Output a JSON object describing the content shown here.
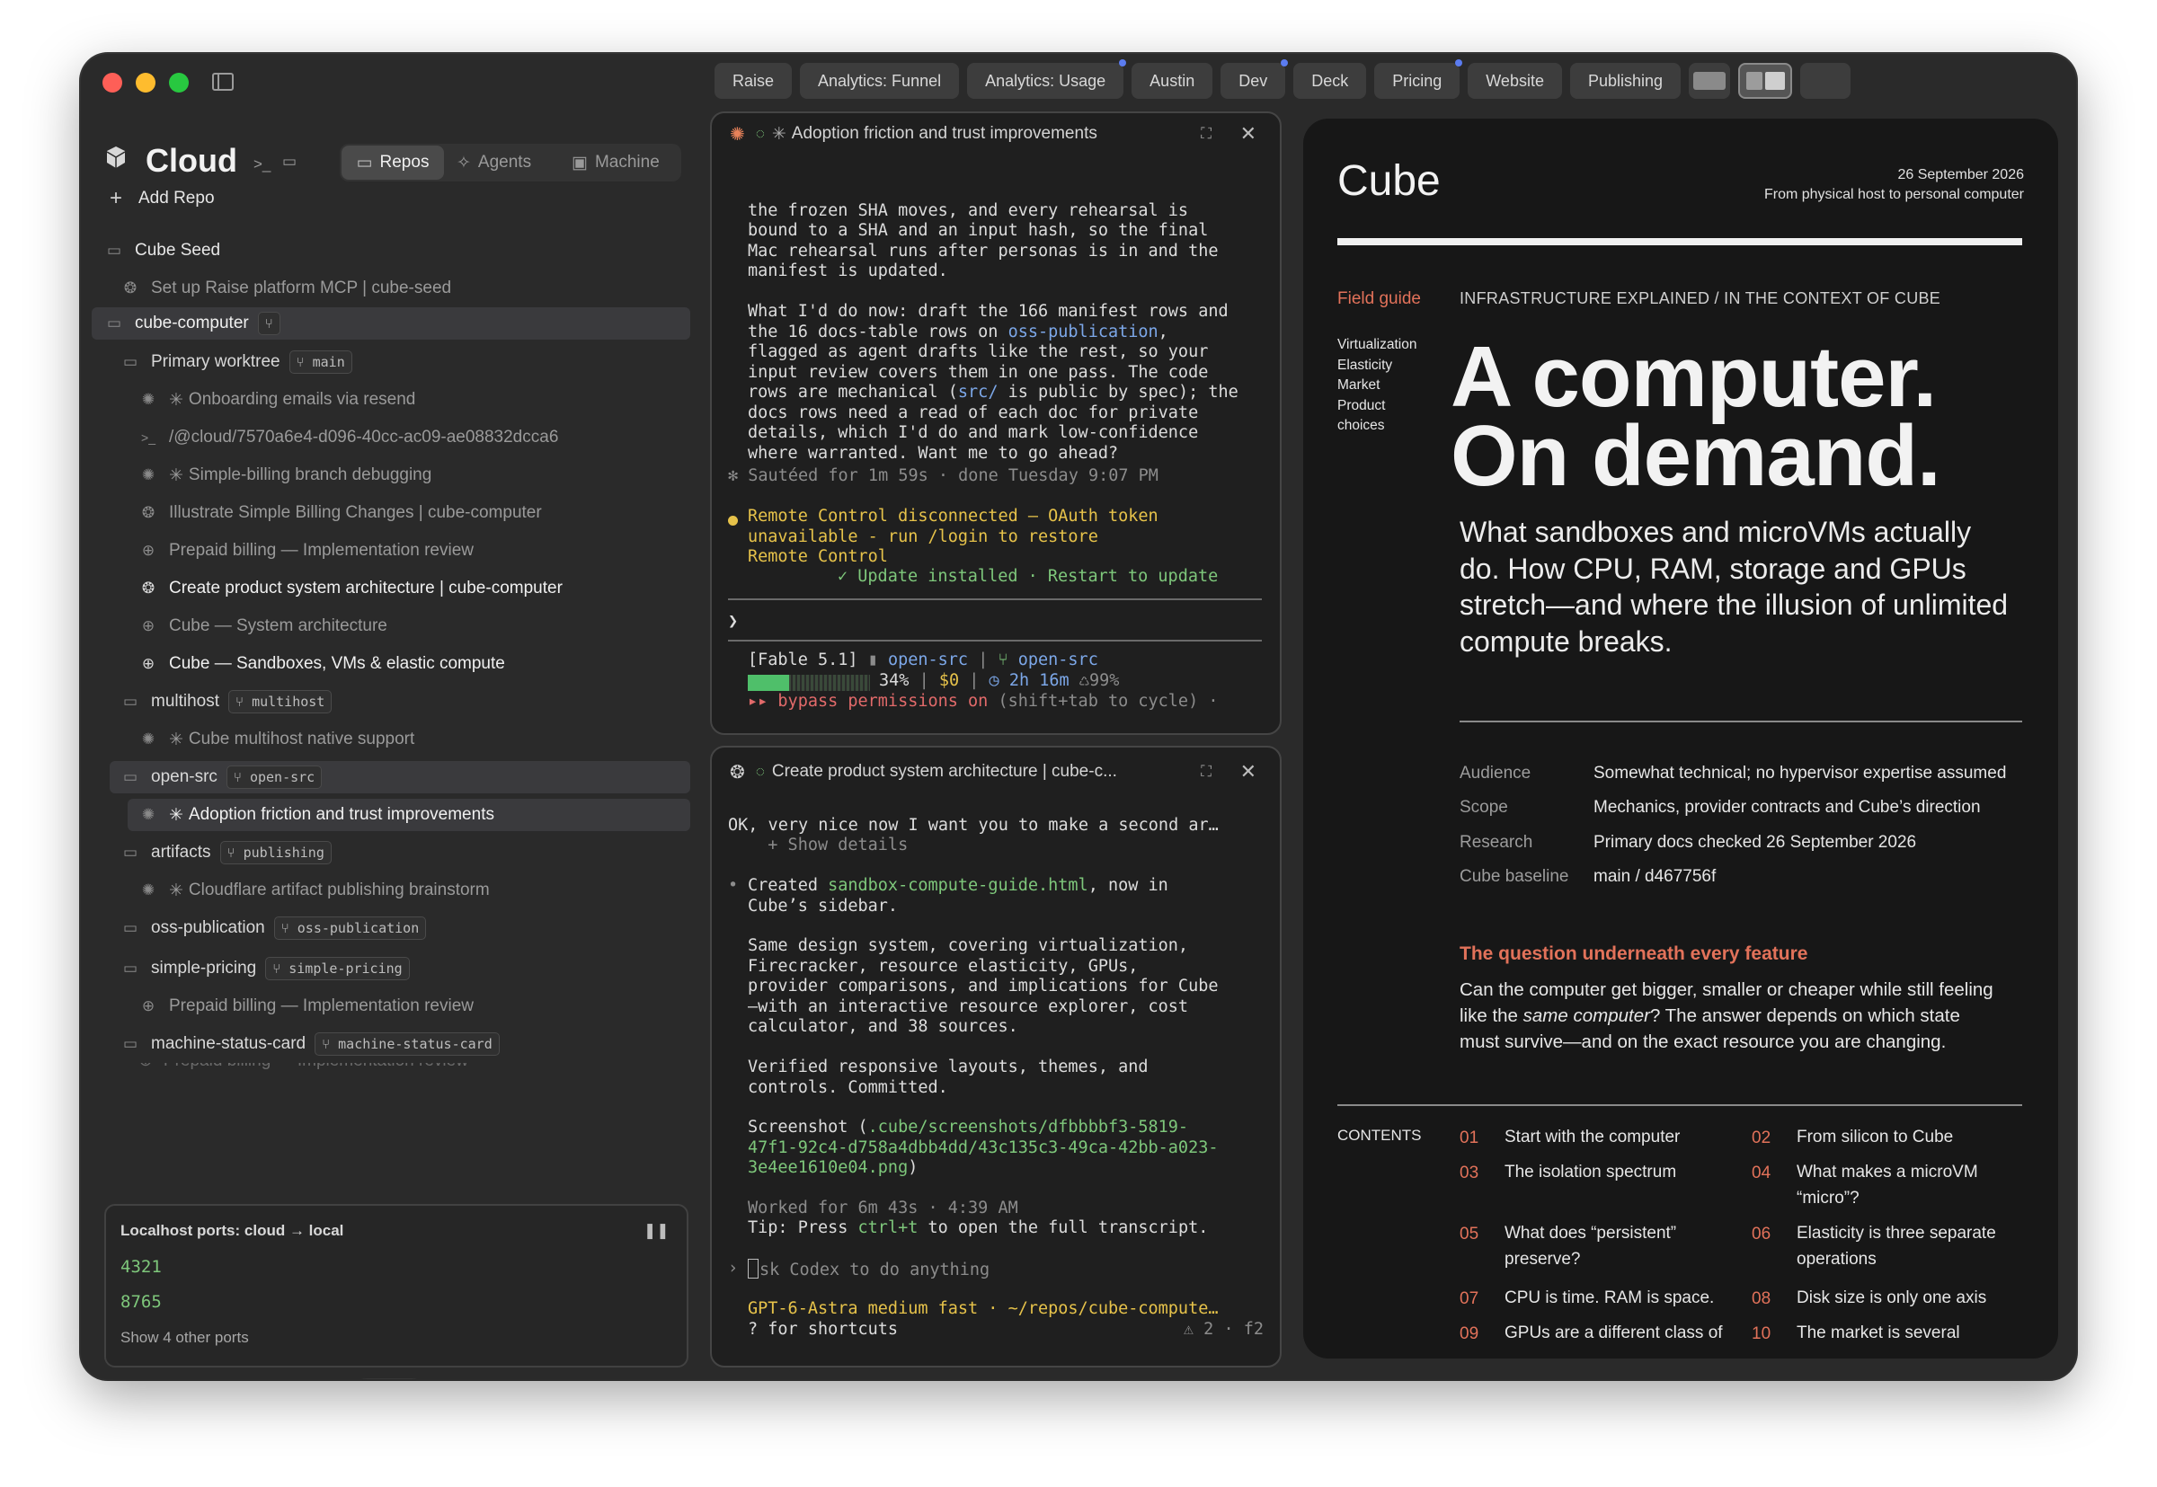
{
  "tabs": [
    {
      "label": "Raise",
      "dot": false
    },
    {
      "label": "Analytics: Funnel",
      "dot": false
    },
    {
      "label": "Analytics: Usage",
      "dot": true
    },
    {
      "label": "Austin",
      "dot": false
    },
    {
      "label": "Dev",
      "dot": true
    },
    {
      "label": "Deck",
      "dot": false
    },
    {
      "label": "Pricing",
      "dot": true
    },
    {
      "label": "Website",
      "dot": false
    },
    {
      "label": "Publishing",
      "dot": false
    }
  ],
  "sidebar": {
    "title": "Cloud",
    "segments": [
      "Repos",
      "Agents",
      "Machine"
    ],
    "add_repo": "Add Repo",
    "cube_seed": "Cube Seed",
    "cube_seed_item": "Set up Raise platform MCP | cube-seed",
    "repo": "cube-computer",
    "primary_worktree": "Primary worktree",
    "primary_branch": "main",
    "items": [
      "Onboarding emails via resend",
      "/@cloud/7570a6e4-d096-40cc-ac09-ae08832dcca6",
      "Simple-billing branch debugging",
      "Illustrate Simple Billing Changes | cube-computer",
      "Prepaid billing — Implementation review",
      "Create product system architecture | cube-computer",
      "Cube — System architecture",
      "Cube — Sandboxes, VMs & elastic compute"
    ],
    "multihost": "multihost",
    "multihost_branch": "multihost",
    "multihost_item": "Cube multihost native support",
    "opensrc": "open-src",
    "opensrc_branch": "open-src",
    "opensrc_item": "Adoption friction and trust improvements",
    "artifacts": "artifacts",
    "artifacts_branch": "publishing",
    "artifacts_item": "Cloudflare artifact publishing brainstorm",
    "osspub": "oss-publication",
    "osspub_branch": "oss-publication",
    "simplepricing": "simple-pricing",
    "simplepricing_branch": "simple-pricing",
    "simplepricing_item": "Prepaid billing — Implementation review",
    "msc": "machine-status-card",
    "msc_branch": "machine-status-card",
    "msc_item_cut": "Prepaid billing — Implementation review",
    "ports": {
      "title": "Localhost ports: cloud → local",
      "port1": "4321",
      "port2": "8765",
      "more": "Show 4 other ports"
    }
  },
  "pane1": {
    "title": "Adoption friction and trust improvements",
    "lines": [
      "the frozen SHA moves, and every rehearsal is",
      "bound to a SHA and an input hash, so the final",
      "Mac rehearsal runs after personas is in and the",
      "manifest is updated.",
      "",
      "What I'd do now: draft the 166 manifest rows and",
      "the 16 docs-table rows on ",
      "flagged as agent drafts like the rest, so your",
      "input review covers them in one pass. The code",
      "rows are mechanical (",
      "docs rows need a read of each doc for private",
      "details, which I'd do and mark low-confidence",
      "where warranted. Want me to go ahead?"
    ],
    "line7_link": "oss-publication",
    "line7_tail": ",",
    "line10_link": "src/",
    "line10_tail": " is public by spec); the",
    "sauteed": "✻ Sautéed for 1m 59s · done Tuesday 9:07 PM",
    "remote1": "Remote Control disconnected — OAuth token",
    "remote2": "unavailable - run /login to restore",
    "remote3": "Remote Control",
    "update": "✓ Update installed · Restart to update",
    "prompt": "❯",
    "status_model": "[Fable 5.1]",
    "status_dir": "open-src",
    "status_branch": "open-src",
    "status_pct": "34%",
    "status_cost": "$0",
    "status_time": "2h 16m",
    "status_cache": "99%",
    "bypass": "▸▸ bypass permissions on",
    "bypass_tail": " (shift+tab to cycle) ·"
  },
  "pane2": {
    "title": "Create product system architecture | cube-c...",
    "l1": "OK, very nice now I want you to make a second ar…",
    "l2": "  + Show details",
    "created_pre": "Created ",
    "created_file": "sandbox-compute-guide.html",
    "created_post": ", now in",
    "created_2": "Cube’s sidebar.",
    "same": [
      "Same design system, covering virtualization,",
      "Firecracker, resource elasticity, GPUs,",
      "provider comparisons, and implications for Cube",
      "—with an interactive resource explorer, cost",
      "calculator, and 38 sources."
    ],
    "verified": [
      "Verified responsive layouts, themes, and",
      "controls. Committed."
    ],
    "shot_pre": "Screenshot (",
    "shot_lines": [
      ".cube/screenshots/dfbbbbf3-5819-",
      "47f1-92c4-d758a4dbb4dd/43c135c3-49ca-42bb-a023-",
      "3e4ee1610e04.png"
    ],
    "shot_post": ")",
    "worked": "Worked for 6m 43s · 4:39 AM",
    "tip_pre": "Tip: Press ",
    "tip_key": "ctrl+t",
    "tip_post": " to open the full transcript.",
    "input_placeholder": "sk Codex to do anything",
    "model": "GPT-6-Astra medium fast · ~/repos/cube-compute…",
    "shortcuts": "? for shortcuts",
    "warn": "⚠ 2 · f2"
  },
  "doc": {
    "brand": "Cube",
    "date": "26 September 2026",
    "tagline": "From physical host to personal computer",
    "field_guide": "Field guide",
    "kicker": "INFRASTRUCTURE EXPLAINED / IN THE CONTEXT OF CUBE",
    "topics": [
      "Virtualization",
      "Elasticity",
      "Market",
      "Product",
      "choices"
    ],
    "headline1": "A computer.",
    "headline2": "On demand.",
    "lede": [
      "What sandboxes and microVMs actually",
      "do. How CPU, RAM, storage and GPUs",
      "stretch—and where the illusion of unlimited",
      "compute breaks."
    ],
    "meta": [
      {
        "k": "Audience",
        "v": "Somewhat technical; no hypervisor expertise assumed"
      },
      {
        "k": "Scope",
        "v": "Mechanics, provider contracts and Cube’s direction"
      },
      {
        "k": "Research",
        "v": "Primary docs checked 26 September 2026"
      },
      {
        "k": "Cube baseline",
        "v": "main / d467756f"
      }
    ],
    "question": "The question underneath every feature",
    "q1": "Can the computer get bigger, smaller or cheaper while still feeling",
    "q2a": "like the ",
    "q2em": "same computer",
    "q2b": "? The answer depends on which state",
    "q3": "must survive—and on the exact resource you are changing.",
    "contents_label": "CONTENTS",
    "contents": [
      {
        "n": "01",
        "t": "Start with the computer"
      },
      {
        "n": "02",
        "t": "From silicon to Cube"
      },
      {
        "n": "03",
        "t": "The isolation spectrum"
      },
      {
        "n": "04",
        "t": "What makes a microVM “micro”?"
      },
      {
        "n": "05",
        "t": "What does “persistent” preserve?"
      },
      {
        "n": "06",
        "t": "Elasticity is three separate operations"
      },
      {
        "n": "07",
        "t": "CPU is time. RAM is space."
      },
      {
        "n": "08",
        "t": "Disk size is only one axis"
      },
      {
        "n": "09",
        "t": "GPUs are a different class of"
      },
      {
        "n": "10",
        "t": "The market is several"
      }
    ]
  }
}
